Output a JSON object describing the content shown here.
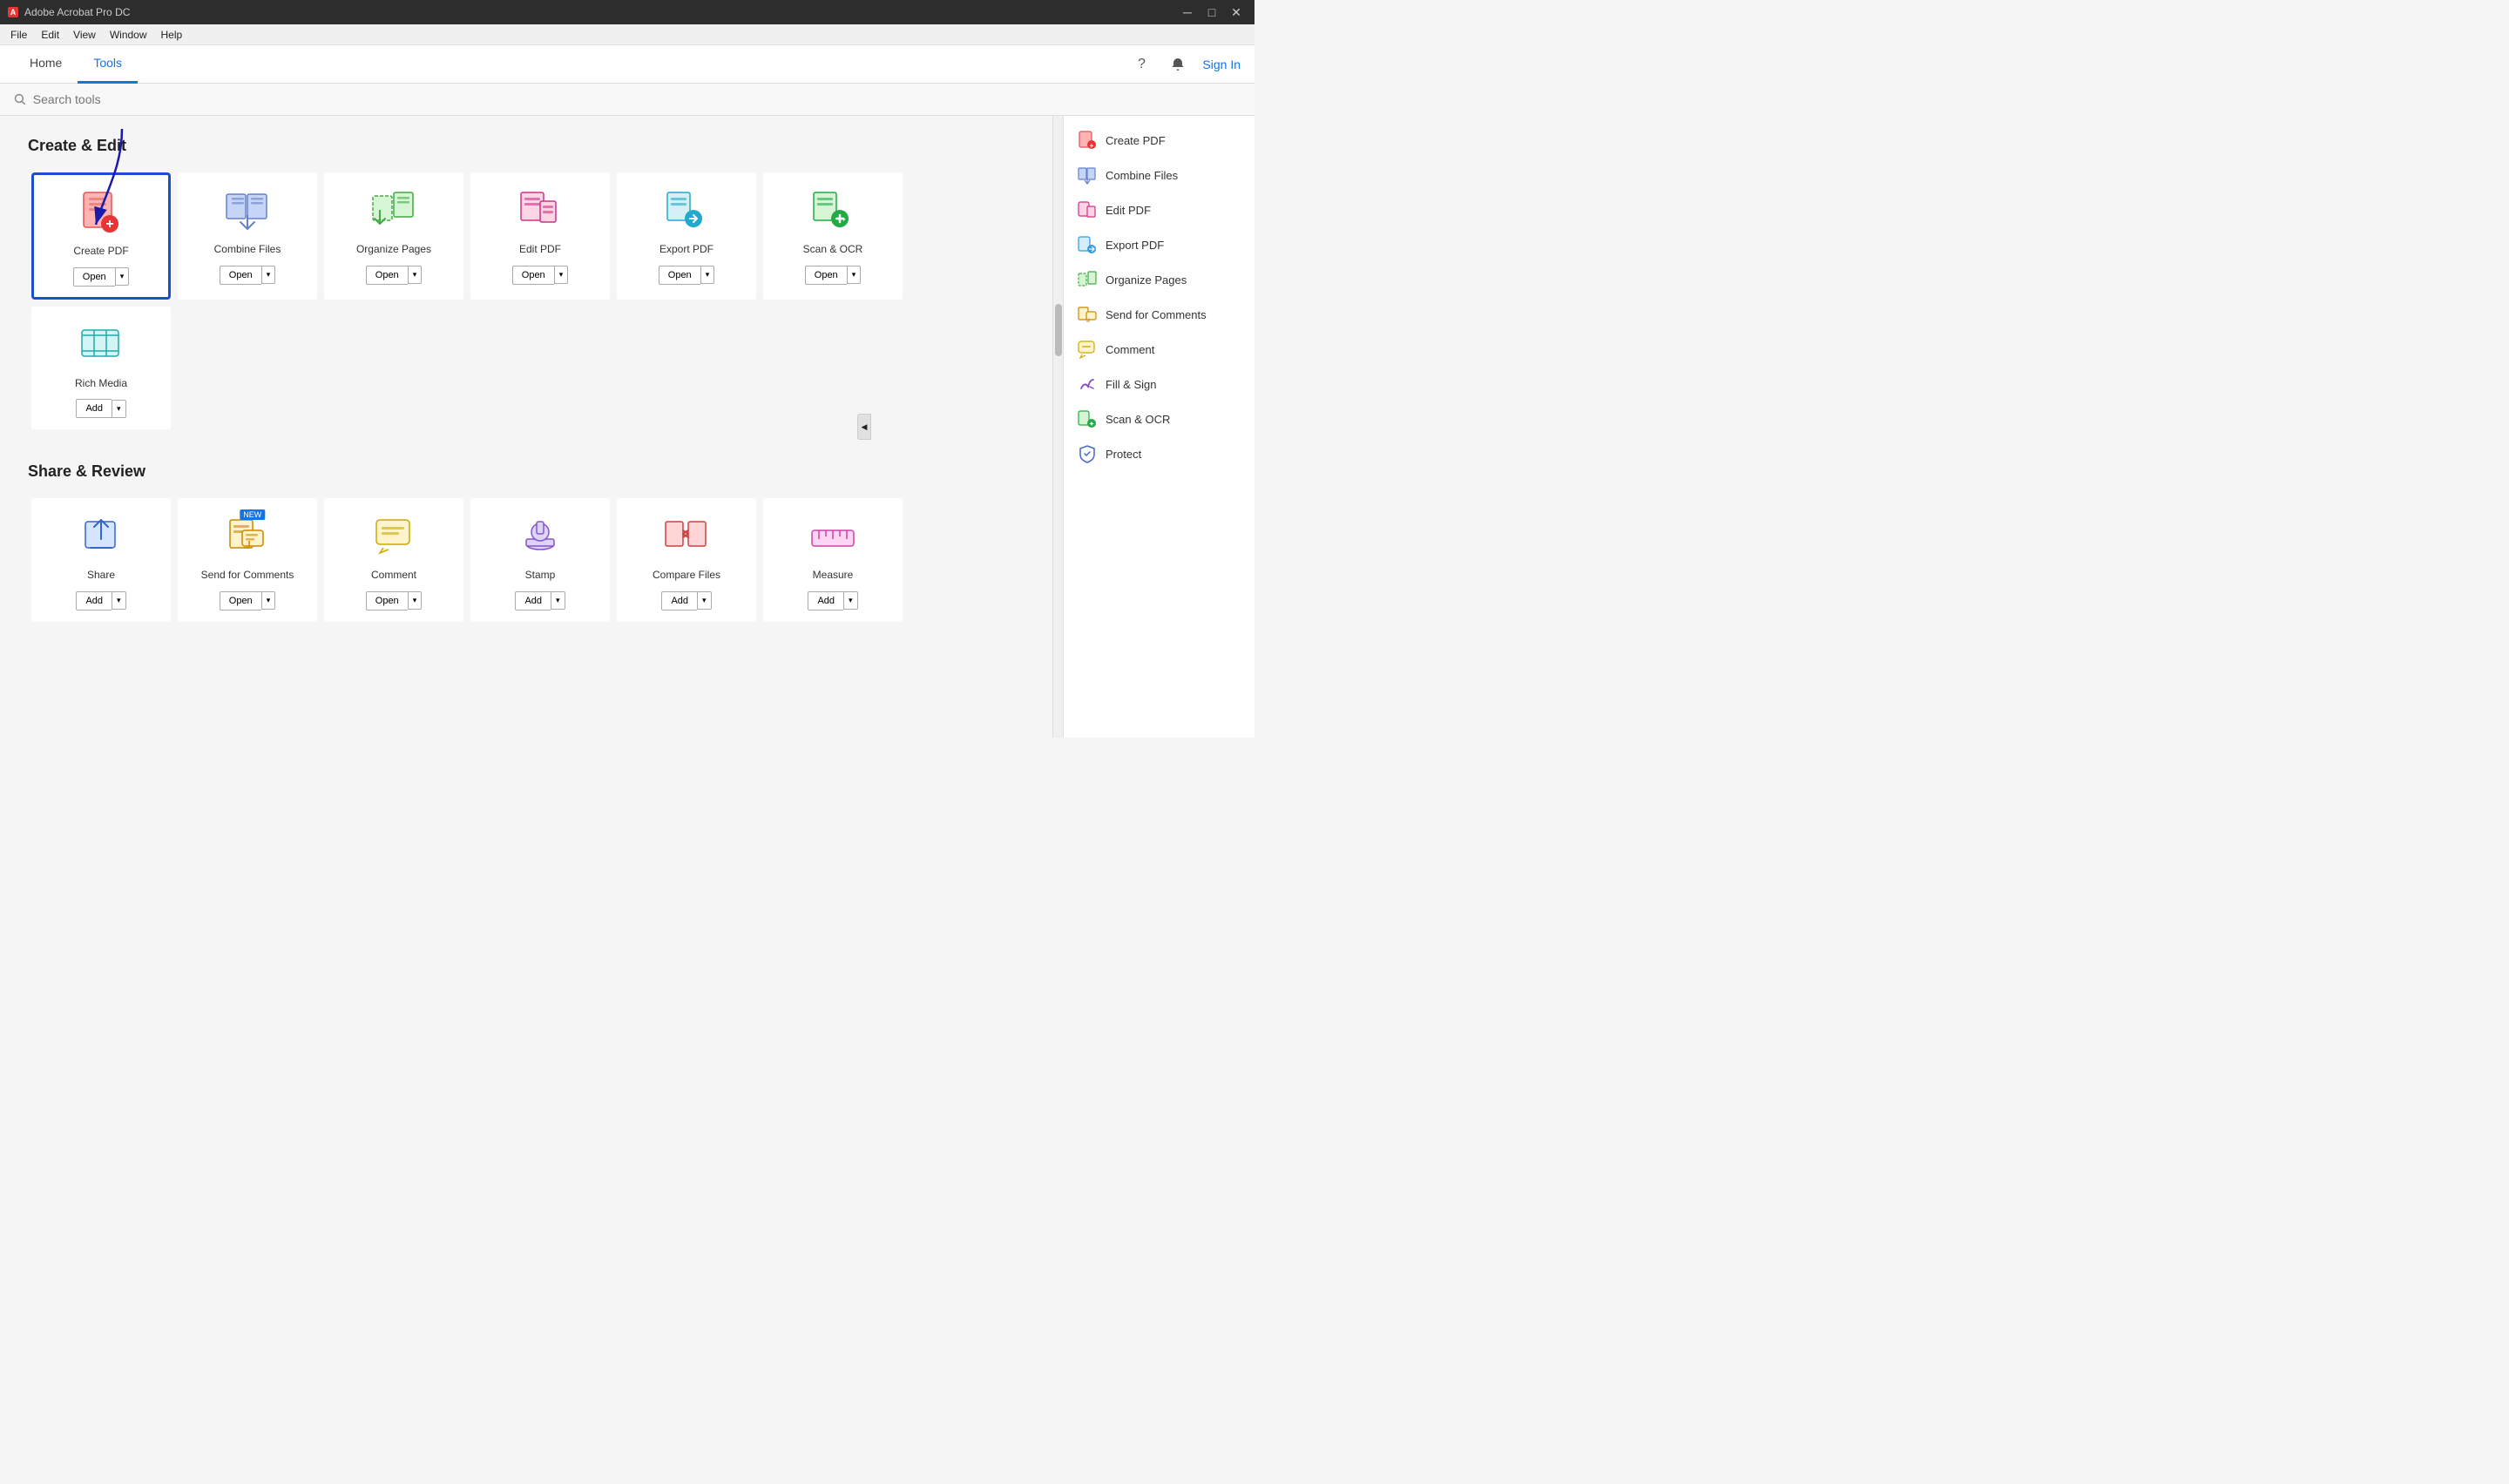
{
  "titleBar": {
    "appName": "Adobe Acrobat Pro DC",
    "minimize": "─",
    "maximize": "□",
    "close": "✕"
  },
  "menuBar": {
    "items": [
      "File",
      "Edit",
      "View",
      "Window",
      "Help"
    ]
  },
  "topNav": {
    "tabs": [
      {
        "label": "Home",
        "active": false
      },
      {
        "label": "Tools",
        "active": true
      }
    ],
    "helpIcon": "?",
    "bellIcon": "🔔",
    "signIn": "Sign In"
  },
  "search": {
    "placeholder": "Search tools"
  },
  "sections": [
    {
      "heading": "Create & Edit",
      "tools": [
        {
          "name": "Create PDF",
          "buttonLabel": "Open",
          "type": "open",
          "highlighted": true,
          "iconType": "create-pdf"
        },
        {
          "name": "Combine Files",
          "buttonLabel": "Open",
          "type": "open",
          "iconType": "combine-files"
        },
        {
          "name": "Organize Pages",
          "buttonLabel": "Open",
          "type": "open",
          "iconType": "organize-pages"
        },
        {
          "name": "Edit PDF",
          "buttonLabel": "Open",
          "type": "open",
          "iconType": "edit-pdf"
        },
        {
          "name": "Export PDF",
          "buttonLabel": "Open",
          "type": "open",
          "iconType": "export-pdf"
        },
        {
          "name": "Scan & OCR",
          "buttonLabel": "Open",
          "type": "open",
          "iconType": "scan-ocr"
        },
        {
          "name": "Rich Media",
          "buttonLabel": "Add",
          "type": "add",
          "iconType": "rich-media"
        }
      ]
    },
    {
      "heading": "Share & Review",
      "tools": [
        {
          "name": "Share",
          "buttonLabel": "Add",
          "type": "add",
          "iconType": "share"
        },
        {
          "name": "Send for Comments",
          "buttonLabel": "Open",
          "type": "open",
          "isNew": true,
          "iconType": "send-comments"
        },
        {
          "name": "Comment",
          "buttonLabel": "Open",
          "type": "open",
          "iconType": "comment"
        },
        {
          "name": "Stamp",
          "buttonLabel": "Add",
          "type": "add",
          "iconType": "stamp"
        },
        {
          "name": "Compare Files",
          "buttonLabel": "Add",
          "type": "add",
          "iconType": "compare-files"
        },
        {
          "name": "Measure",
          "buttonLabel": "Add",
          "type": "add",
          "iconType": "measure"
        }
      ]
    }
  ],
  "sidebar": {
    "items": [
      {
        "label": "Create PDF",
        "iconType": "create-pdf-side"
      },
      {
        "label": "Combine Files",
        "iconType": "combine-files-side"
      },
      {
        "label": "Edit PDF",
        "iconType": "edit-pdf-side"
      },
      {
        "label": "Export PDF",
        "iconType": "export-pdf-side"
      },
      {
        "label": "Organize Pages",
        "iconType": "organize-pages-side"
      },
      {
        "label": "Send for Comments",
        "iconType": "send-comments-side"
      },
      {
        "label": "Comment",
        "iconType": "comment-side"
      },
      {
        "label": "Fill & Sign",
        "iconType": "fill-sign-side"
      },
      {
        "label": "Scan & OCR",
        "iconType": "scan-ocr-side"
      },
      {
        "label": "Protect",
        "iconType": "protect-side"
      }
    ]
  }
}
